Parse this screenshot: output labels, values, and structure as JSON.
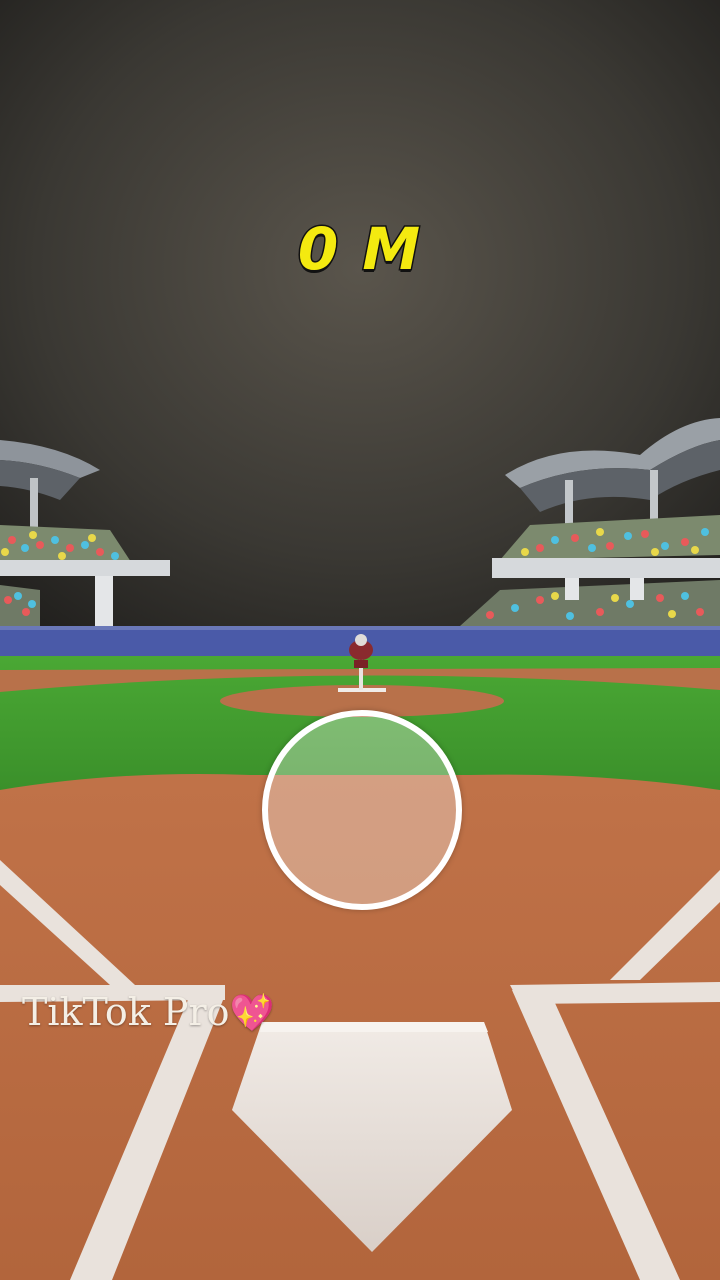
{
  "hud": {
    "distance": "0 M"
  },
  "watermark": {
    "text": "TikTok Pro",
    "emoji": "💖"
  },
  "colors": {
    "sky_center": "#55514a",
    "sky_edge": "#232220",
    "grass": "#3f9a2e",
    "dirt": "#b86a3e",
    "chalk": "#e9e2dc",
    "distance_text": "#f4ea10",
    "wall": "#4a5aa8"
  },
  "icons": {
    "aim_reticle": "aim-circle-icon",
    "watermark_heart": "sparkling-heart-icon"
  }
}
